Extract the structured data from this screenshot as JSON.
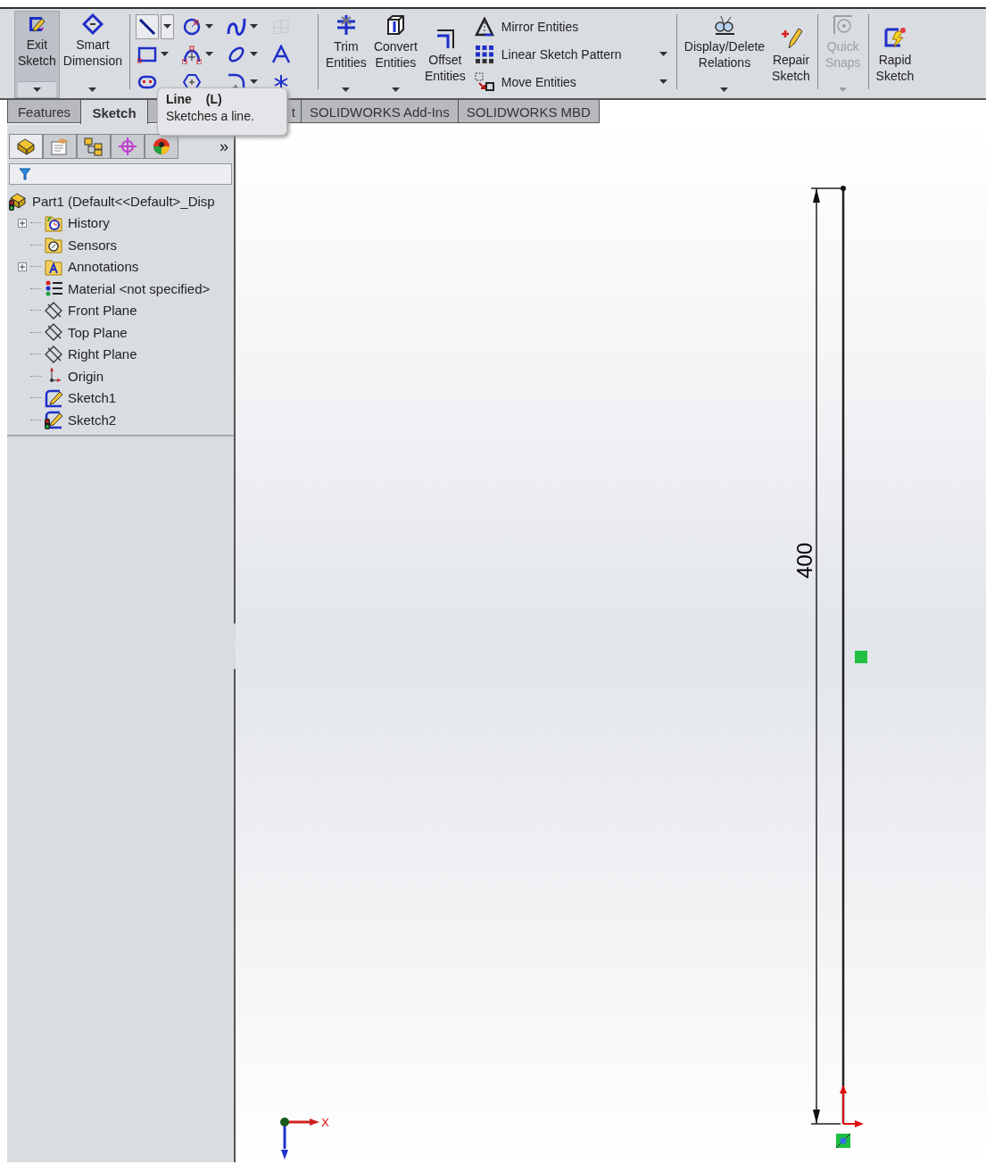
{
  "toolbar": {
    "items": [
      {
        "kind": "large",
        "label": "Exit\nSketch",
        "selected": true,
        "dropdown": true,
        "disabled": false
      },
      {
        "kind": "large",
        "label": "Smart\nDimension",
        "selected": false,
        "dropdown": true,
        "disabled": false
      },
      {
        "kind": "separator"
      },
      {
        "kind": "grid",
        "tools": [
          {
            "selected": true,
            "dropdown": true,
            "disabled": false
          },
          {
            "selected": false,
            "dropdown": true,
            "disabled": false
          },
          {
            "selected": false,
            "dropdown": true,
            "disabled": false
          },
          {
            "selected": false,
            "dropdown": false,
            "disabled": true
          },
          {
            "selected": false,
            "dropdown": true,
            "disabled": false
          },
          {
            "selected": false,
            "dropdown": true,
            "disabled": false
          },
          {
            "selected": false,
            "dropdown": true,
            "disabled": false
          },
          {
            "selected": false,
            "dropdown": false,
            "disabled": false
          },
          {
            "selected": false,
            "dropdown": false,
            "disabled": false
          },
          {
            "selected": false,
            "dropdown": false,
            "disabled": false
          },
          {
            "selected": false,
            "dropdown": true,
            "disabled": false
          },
          {
            "selected": false,
            "dropdown": false,
            "disabled": false
          }
        ]
      },
      {
        "kind": "separator"
      },
      {
        "kind": "large",
        "label": "Trim\nEntities",
        "selected": false,
        "dropdown": true,
        "disabled": false
      },
      {
        "kind": "large",
        "label": "Convert\nEntities",
        "selected": false,
        "dropdown": true,
        "disabled": false
      },
      {
        "kind": "large",
        "label": "Offset\nEntities",
        "selected": false,
        "dropdown": false,
        "disabled": false
      },
      {
        "kind": "list",
        "entries": [
          {
            "label": "Mirror Entities",
            "dropdown": false
          },
          {
            "label": "Linear Sketch Pattern",
            "dropdown": true
          },
          {
            "label": "Move Entities",
            "dropdown": true
          }
        ]
      },
      {
        "kind": "separator"
      },
      {
        "kind": "large",
        "label": "Display/Delete\nRelations",
        "selected": false,
        "dropdown": true,
        "disabled": false
      },
      {
        "kind": "large",
        "label": "Repair\nSketch",
        "selected": false,
        "dropdown": false,
        "disabled": false
      },
      {
        "kind": "separator"
      },
      {
        "kind": "large",
        "label": "Quick\nSnaps",
        "selected": false,
        "dropdown": true,
        "disabled": true
      },
      {
        "kind": "separator"
      },
      {
        "kind": "large",
        "label": "Rapid\nSketch",
        "selected": false,
        "dropdown": false,
        "disabled": false
      }
    ]
  },
  "tabs": [
    {
      "label": "Features",
      "selected": false
    },
    {
      "label": "Sketch",
      "selected": true
    },
    {
      "label": "t",
      "selected": false
    },
    {
      "label": "SOLIDWORKS Add-Ins",
      "selected": false
    },
    {
      "label": "SOLIDWORKS MBD",
      "selected": false
    }
  ],
  "tooltip": {
    "title": "Line",
    "shortcut": "(L)",
    "description": "Sketches a line."
  },
  "panel": {
    "tabs": [
      {
        "selected": true
      },
      {
        "selected": false
      },
      {
        "selected": false
      },
      {
        "selected": false
      },
      {
        "selected": false
      }
    ],
    "more": "»",
    "tree": {
      "label": "Part1  (Default<<Default>_Disp",
      "kind": "part",
      "error": true,
      "children": [
        {
          "label": "History",
          "kind": "history",
          "expandable": true,
          "error": false
        },
        {
          "label": "Sensors",
          "kind": "sensors",
          "expandable": false,
          "error": false
        },
        {
          "label": "Annotations",
          "kind": "annotations",
          "expandable": true,
          "error": false
        },
        {
          "label": "Material <not specified>",
          "kind": "material",
          "expandable": false,
          "error": false
        },
        {
          "label": "Front Plane",
          "kind": "plane",
          "expandable": false,
          "error": false
        },
        {
          "label": "Top Plane",
          "kind": "plane",
          "expandable": false,
          "error": false
        },
        {
          "label": "Right Plane",
          "kind": "plane",
          "expandable": false,
          "error": false
        },
        {
          "label": "Origin",
          "kind": "origin",
          "expandable": false,
          "error": false
        },
        {
          "label": "Sketch1",
          "kind": "sketch",
          "expandable": false,
          "error": false
        },
        {
          "label": "Sketch2",
          "kind": "sketch",
          "expandable": false,
          "error": true
        }
      ]
    }
  },
  "viewport": {
    "dimension": "400",
    "axis_label": "X"
  }
}
